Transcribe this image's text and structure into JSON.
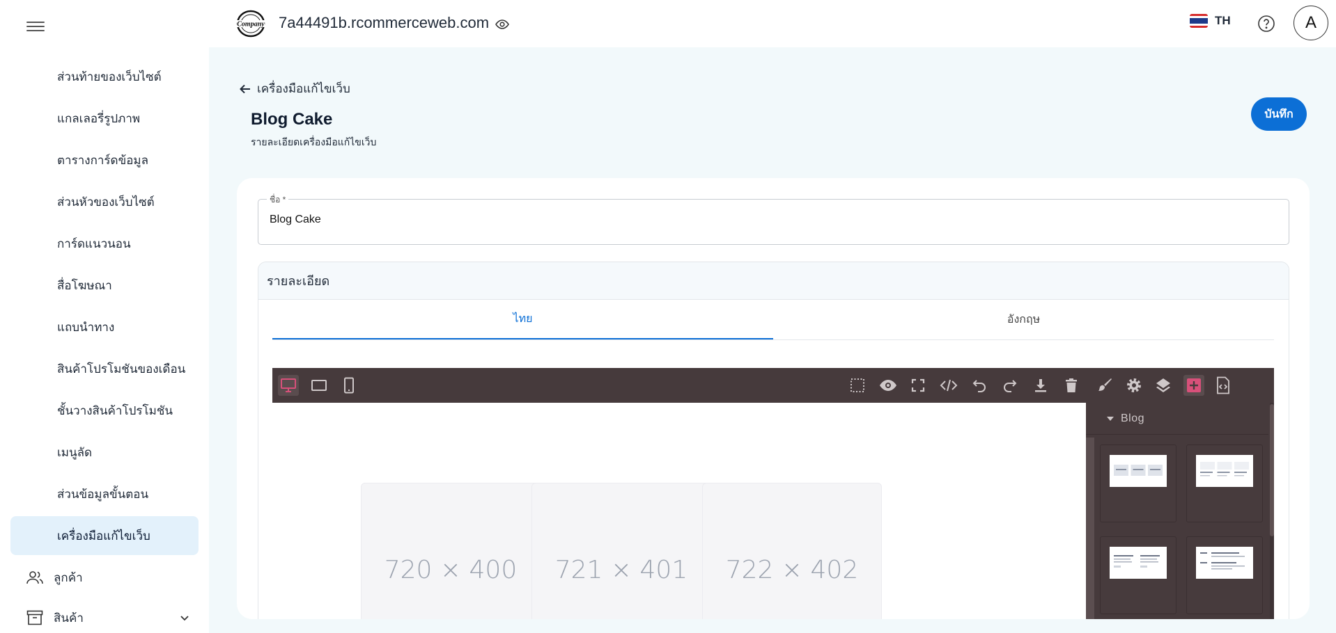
{
  "sidebar": {
    "items": [
      {
        "label": "ส่วนท้ายของเว็บไซต์",
        "active": false
      },
      {
        "label": "แกลเลอรี่รูปภาพ",
        "active": false
      },
      {
        "label": "ตารางการ์ดข้อมูล",
        "active": false
      },
      {
        "label": "ส่วนหัวของเว็บไซต์",
        "active": false
      },
      {
        "label": "การ์ดแนวนอน",
        "active": false
      },
      {
        "label": "สื่อโฆษณา",
        "active": false
      },
      {
        "label": "แถบนำทาง",
        "active": false
      },
      {
        "label": "สินค้าโปรโมชันของเดือน",
        "active": false
      },
      {
        "label": "ชั้นวางสินค้าโปรโมชัน",
        "active": false
      },
      {
        "label": "เมนูลัด",
        "active": false
      },
      {
        "label": "ส่วนข้อมูลขั้นตอน",
        "active": false
      },
      {
        "label": "เครื่องมือแก้ไขเว็บ",
        "active": true
      }
    ],
    "customers": {
      "label": "ลูกค้า",
      "icon": "users-icon"
    },
    "products": {
      "label": "สินค้า",
      "icon": "archive-box-icon"
    }
  },
  "topbar": {
    "domain": "7a44491b.rcommerceweb.com",
    "logo_text": "Company",
    "lang": "TH",
    "avatar": "A"
  },
  "header": {
    "back_label": "เครื่องมือแก้ไขเว็บ",
    "title": "Blog Cake",
    "subtitle": "รายละเอียดเครื่องมือแก้ไขเว็บ",
    "save_label": "บันทึก"
  },
  "form": {
    "name_label": "ชื่อ *",
    "name_value": "Blog Cake",
    "details_title": "รายละเอียด",
    "tabs": [
      {
        "label": "ไทย",
        "active": true
      },
      {
        "label": "อังกฤษ",
        "active": false
      }
    ]
  },
  "editor": {
    "placeholders": [
      "720 × 400",
      "721 × 401",
      "722 × 402"
    ],
    "panel_category": "Blog"
  },
  "colors": {
    "primary": "#0c6fd6",
    "active_nav_bg": "#e3f1fb",
    "editor_dark": "#463a3c",
    "editor_accent": "#d8507a"
  }
}
